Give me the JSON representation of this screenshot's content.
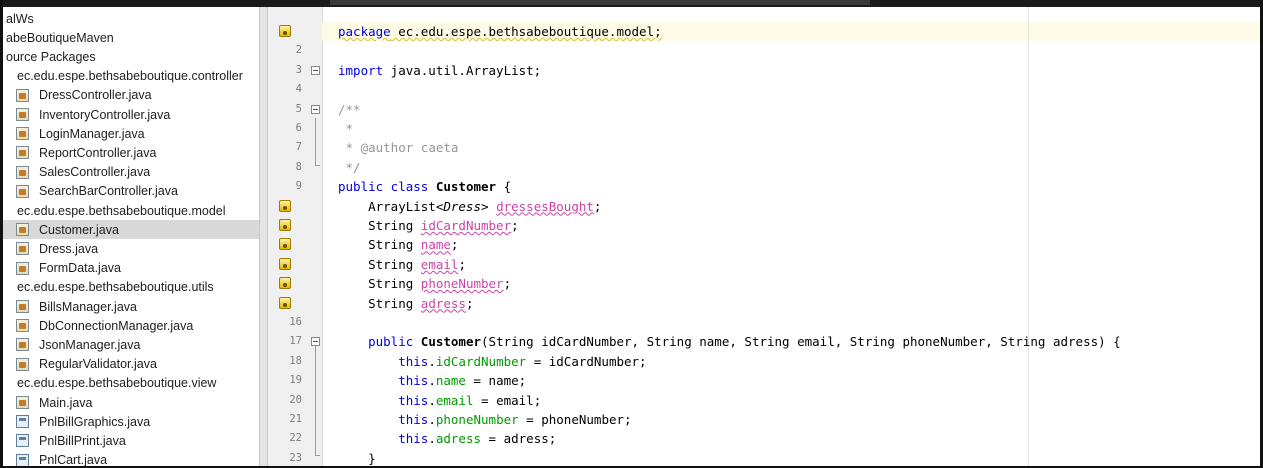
{
  "tree": {
    "items": [
      {
        "label": "alWs",
        "indent": 0,
        "icon": "none"
      },
      {
        "label": "abeBoutiqueMaven",
        "indent": 0,
        "icon": "none"
      },
      {
        "label": "ource Packages",
        "indent": 0,
        "icon": "none"
      },
      {
        "label": "ec.edu.espe.bethsabeboutique.controller",
        "indent": 1,
        "icon": "package"
      },
      {
        "label": "DressController.java",
        "indent": 2,
        "icon": "java"
      },
      {
        "label": "InventoryController.java",
        "indent": 2,
        "icon": "java"
      },
      {
        "label": "LoginManager.java",
        "indent": 2,
        "icon": "java"
      },
      {
        "label": "ReportController.java",
        "indent": 2,
        "icon": "java"
      },
      {
        "label": "SalesController.java",
        "indent": 2,
        "icon": "java"
      },
      {
        "label": "SearchBarController.java",
        "indent": 2,
        "icon": "java"
      },
      {
        "label": "ec.edu.espe.bethsabeboutique.model",
        "indent": 1,
        "icon": "package"
      },
      {
        "label": "Customer.java",
        "indent": 2,
        "icon": "java",
        "selected": true
      },
      {
        "label": "Dress.java",
        "indent": 2,
        "icon": "java"
      },
      {
        "label": "FormData.java",
        "indent": 2,
        "icon": "java"
      },
      {
        "label": "ec.edu.espe.bethsabeboutique.utils",
        "indent": 1,
        "icon": "package"
      },
      {
        "label": "BillsManager.java",
        "indent": 2,
        "icon": "java"
      },
      {
        "label": "DbConnectionManager.java",
        "indent": 2,
        "icon": "java"
      },
      {
        "label": "JsonManager.java",
        "indent": 2,
        "icon": "java"
      },
      {
        "label": "RegularValidator.java",
        "indent": 2,
        "icon": "java"
      },
      {
        "label": "ec.edu.espe.bethsabeboutique.view",
        "indent": 1,
        "icon": "package"
      },
      {
        "label": "Main.java",
        "indent": 2,
        "icon": "java"
      },
      {
        "label": "PnlBillGraphics.java",
        "indent": 2,
        "icon": "form"
      },
      {
        "label": "PnlBillPrint.java",
        "indent": 2,
        "icon": "form"
      },
      {
        "label": "PnlCart.java",
        "indent": 2,
        "icon": "form"
      }
    ]
  },
  "editor": {
    "lines": [
      {
        "n": "",
        "badge": true,
        "tokens": [
          [
            "package",
            "kw ul"
          ],
          [
            " ec.edu.espe.bethsabeboutique.model;",
            "ul"
          ]
        ]
      },
      {
        "n": "2",
        "tokens": []
      },
      {
        "n": "3",
        "fold": true,
        "tokens": [
          [
            "import",
            "kw"
          ],
          [
            " java.util.ArrayList;",
            ""
          ]
        ]
      },
      {
        "n": "4",
        "tokens": []
      },
      {
        "n": "5",
        "fold": true,
        "tokens": [
          [
            "/**",
            "cm"
          ]
        ]
      },
      {
        "n": "6",
        "tokens": [
          [
            " *",
            "cm"
          ]
        ]
      },
      {
        "n": "7",
        "tokens": [
          [
            " * ",
            "cm"
          ],
          [
            "@author",
            "tag"
          ],
          [
            " caeta",
            "cm"
          ]
        ]
      },
      {
        "n": "8",
        "tokens": [
          [
            " */",
            "cm"
          ]
        ]
      },
      {
        "n": "9",
        "tokens": [
          [
            "public class ",
            "kw"
          ],
          [
            "Customer",
            "typ"
          ],
          [
            " {",
            ""
          ]
        ]
      },
      {
        "n": "",
        "badge": true,
        "tokens": [
          [
            "    ArrayList<",
            ""
          ],
          [
            "Dress",
            "it"
          ],
          [
            "> ",
            ""
          ],
          [
            "dressesBought",
            "uf"
          ],
          [
            ";",
            ""
          ]
        ]
      },
      {
        "n": "",
        "badge": true,
        "tokens": [
          [
            "    String ",
            ""
          ],
          [
            "idCardNumber",
            "uf"
          ],
          [
            ";",
            ""
          ]
        ]
      },
      {
        "n": "",
        "badge": true,
        "tokens": [
          [
            "    String ",
            ""
          ],
          [
            "name",
            "uf"
          ],
          [
            ";",
            ""
          ]
        ]
      },
      {
        "n": "",
        "badge": true,
        "tokens": [
          [
            "    String ",
            ""
          ],
          [
            "email",
            "uf"
          ],
          [
            ";",
            ""
          ]
        ]
      },
      {
        "n": "",
        "badge": true,
        "tokens": [
          [
            "    String ",
            ""
          ],
          [
            "phoneNumber",
            "uf"
          ],
          [
            ";",
            ""
          ]
        ]
      },
      {
        "n": "",
        "badge": true,
        "tokens": [
          [
            "    String ",
            ""
          ],
          [
            "adress",
            "uf"
          ],
          [
            ";",
            ""
          ]
        ]
      },
      {
        "n": "16",
        "tokens": []
      },
      {
        "n": "17",
        "fold": true,
        "tokens": [
          [
            "    public ",
            "kw"
          ],
          [
            "Customer",
            "typ"
          ],
          [
            "(String idCardNumber, String name, String email, String phoneNumber, String adress) {",
            ""
          ]
        ]
      },
      {
        "n": "18",
        "tokens": [
          [
            "        ",
            ""
          ],
          [
            "this",
            "kw"
          ],
          [
            ".",
            ""
          ],
          [
            "idCardNumber",
            "fld"
          ],
          [
            " = idCardNumber;",
            ""
          ]
        ]
      },
      {
        "n": "19",
        "tokens": [
          [
            "        ",
            ""
          ],
          [
            "this",
            "kw"
          ],
          [
            ".",
            ""
          ],
          [
            "name",
            "fld"
          ],
          [
            " = name;",
            ""
          ]
        ]
      },
      {
        "n": "20",
        "tokens": [
          [
            "        ",
            ""
          ],
          [
            "this",
            "kw"
          ],
          [
            ".",
            ""
          ],
          [
            "email",
            "fld"
          ],
          [
            " = email;",
            ""
          ]
        ]
      },
      {
        "n": "21",
        "tokens": [
          [
            "        ",
            ""
          ],
          [
            "this",
            "kw"
          ],
          [
            ".",
            ""
          ],
          [
            "phoneNumber",
            "fld"
          ],
          [
            " = phoneNumber;",
            ""
          ]
        ]
      },
      {
        "n": "22",
        "tokens": [
          [
            "        ",
            ""
          ],
          [
            "this",
            "kw"
          ],
          [
            ".",
            ""
          ],
          [
            "adress",
            "fld"
          ],
          [
            " = adress;",
            ""
          ]
        ]
      },
      {
        "n": "23",
        "tokens": [
          [
            "    }",
            ""
          ]
        ]
      }
    ]
  }
}
